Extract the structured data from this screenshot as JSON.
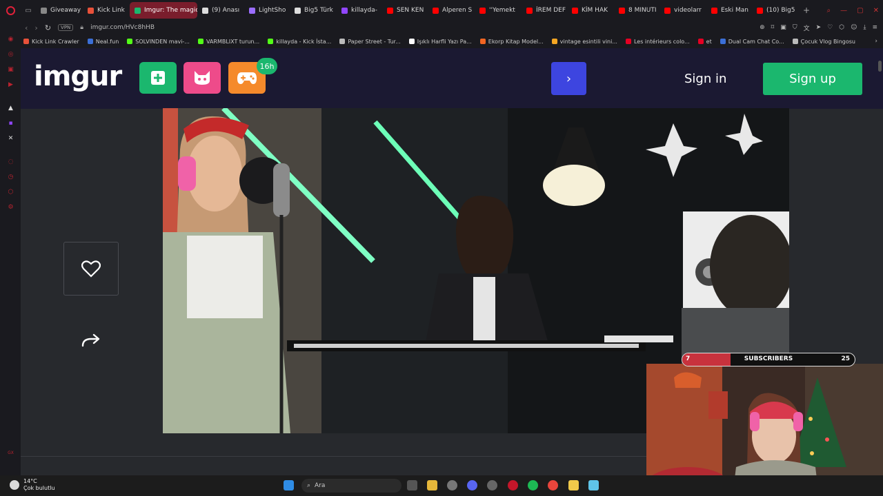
{
  "browser": {
    "tabs": [
      {
        "label": "Giveaway",
        "color": "#888888"
      },
      {
        "label": "Kick Link",
        "color": "#e8513a"
      },
      {
        "label": "Imgur: The magic",
        "color": "#1bb76e",
        "active": true
      },
      {
        "label": "(9) Anası",
        "color": "#dddddd"
      },
      {
        "label": "LightSho",
        "color": "#9b6dff"
      },
      {
        "label": "Big5 Türk",
        "color": "#dddddd"
      },
      {
        "label": "killayda-",
        "color": "#9146ff"
      },
      {
        "label": "SEN KEN",
        "color": "#ff0000"
      },
      {
        "label": "Alperen S",
        "color": "#ff0000"
      },
      {
        "label": "''Yemekt",
        "color": "#ff0000"
      },
      {
        "label": "İREM DEF",
        "color": "#ff0000"
      },
      {
        "label": "KİM HAK",
        "color": "#ff0000"
      },
      {
        "label": "8 MINUTI",
        "color": "#ff0000"
      },
      {
        "label": "videolarr",
        "color": "#ff0000"
      },
      {
        "label": "Eski Man",
        "color": "#ff0000"
      },
      {
        "label": "(10) Big5",
        "color": "#ff0000"
      }
    ],
    "new_tab": "+",
    "vpn": "VPN",
    "url": "imgur.com/HVc8hHB"
  },
  "bookmarks": [
    {
      "label": "Kick Link Crawler",
      "color": "#e8513a"
    },
    {
      "label": "Neal.fun",
      "color": "#3b6fd6"
    },
    {
      "label": "SOLVINDEN mavi-...",
      "color": "#53fc18"
    },
    {
      "label": "VARMBLIXT turun...",
      "color": "#53fc18"
    },
    {
      "label": "killayda - Kick İsta...",
      "color": "#53fc18"
    },
    {
      "label": "Paper Street - Tur...",
      "color": "#bbbbbb"
    },
    {
      "label": "Işıklı Harfli Yazı Pa...",
      "color": "#ffffff"
    },
    {
      "label": "Ekorp Kitap Model...",
      "color": "#f26522"
    },
    {
      "label": "vintage esintili vini...",
      "color": "#f5a623"
    },
    {
      "label": "Les intérieurs colo...",
      "color": "#e60023"
    },
    {
      "label": "et",
      "color": "#e60023"
    },
    {
      "label": "Dual Cam Chat Co...",
      "color": "#3b6fd6"
    },
    {
      "label": "Çocuk Vlog Bingosu",
      "color": "#bbbbbb"
    }
  ],
  "imgur": {
    "logo": "imgur",
    "badge": "16h",
    "sign_in": "Sign in",
    "sign_up": "Sign up"
  },
  "subscribers": {
    "label": "SUBSCRIBERS",
    "current": "7",
    "goal": "25",
    "progress": 0.28
  },
  "taskbar": {
    "temperature": "14°C",
    "weather": "Çok bulutlu",
    "search": "Ara"
  },
  "colors": {
    "imgur_header": "#1b1932",
    "imgur_green": "#1bb76e",
    "next_blue": "#3d45e0",
    "active_tab": "#7a1d2c"
  }
}
